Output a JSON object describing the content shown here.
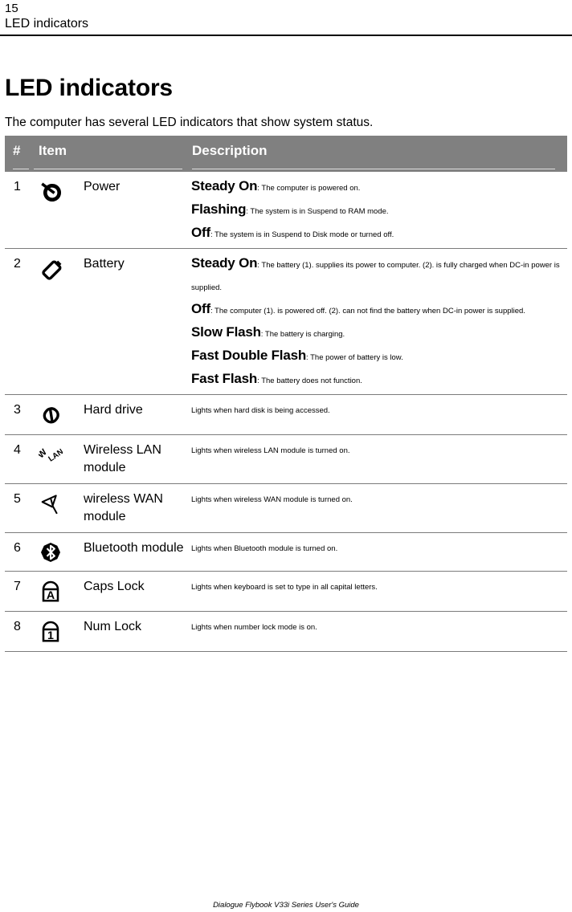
{
  "running_head": {
    "page_number": "15",
    "title": "LED indicators"
  },
  "section": {
    "heading": "LED indicators",
    "intro": "The computer has several LED indicators that show system status."
  },
  "table": {
    "headers": {
      "number": "#",
      "item": "Item",
      "description": "Description"
    },
    "rows": [
      {
        "number": "1",
        "icon": "power-icon",
        "item": "Power",
        "lines": [
          {
            "state": "Steady On",
            "text": ": The computer is powered on."
          },
          {
            "state": "Flashing",
            "text": ": The system is in Suspend to RAM mode."
          },
          {
            "state": "Off",
            "text": ": The system is in Suspend to Disk mode or turned off."
          }
        ]
      },
      {
        "number": "2",
        "icon": "battery-icon",
        "item": "Battery",
        "lines": [
          {
            "state": "Steady On",
            "text": ": The battery (1). supplies its power to computer. (2). is fully charged when DC-in power is"
          },
          {
            "state": "",
            "text": "supplied."
          },
          {
            "state": "Off",
            "text": ": The computer (1). is powered off. (2). can not find the battery when DC-in power is supplied."
          },
          {
            "state": "Slow Flash",
            "text": ": The battery is charging."
          },
          {
            "state": "Fast Double Flash",
            "text": ": The power of battery is low."
          },
          {
            "state": "Fast Flash",
            "text": ": The battery does not function."
          }
        ]
      },
      {
        "number": "3",
        "icon": "hard-drive-icon",
        "item": "Hard drive",
        "plain": "Lights when hard disk is being accessed."
      },
      {
        "number": "4",
        "icon": "wireless-lan-icon",
        "item": "Wireless LAN module",
        "plain": "Lights when wireless LAN module is turned on."
      },
      {
        "number": "5",
        "icon": "wireless-wan-icon",
        "item": "wireless WAN module",
        "plain": "Lights when wireless WAN module is turned on."
      },
      {
        "number": "6",
        "icon": "bluetooth-icon",
        "item": "Bluetooth module",
        "plain": "Lights when Bluetooth module is turned on."
      },
      {
        "number": "7",
        "icon": "caps-lock-icon",
        "item": "Caps Lock",
        "plain": "Lights when keyboard is set to type in all capital letters."
      },
      {
        "number": "8",
        "icon": "num-lock-icon",
        "item": "Num Lock",
        "plain": "Lights when number lock mode is on."
      }
    ]
  },
  "footer": {
    "text": "Dialogue Flybook V33i Series User's Guide"
  },
  "colors": {
    "header_bg": "#808080",
    "rule": "#000000",
    "row_divider": "#7b7b7b"
  }
}
